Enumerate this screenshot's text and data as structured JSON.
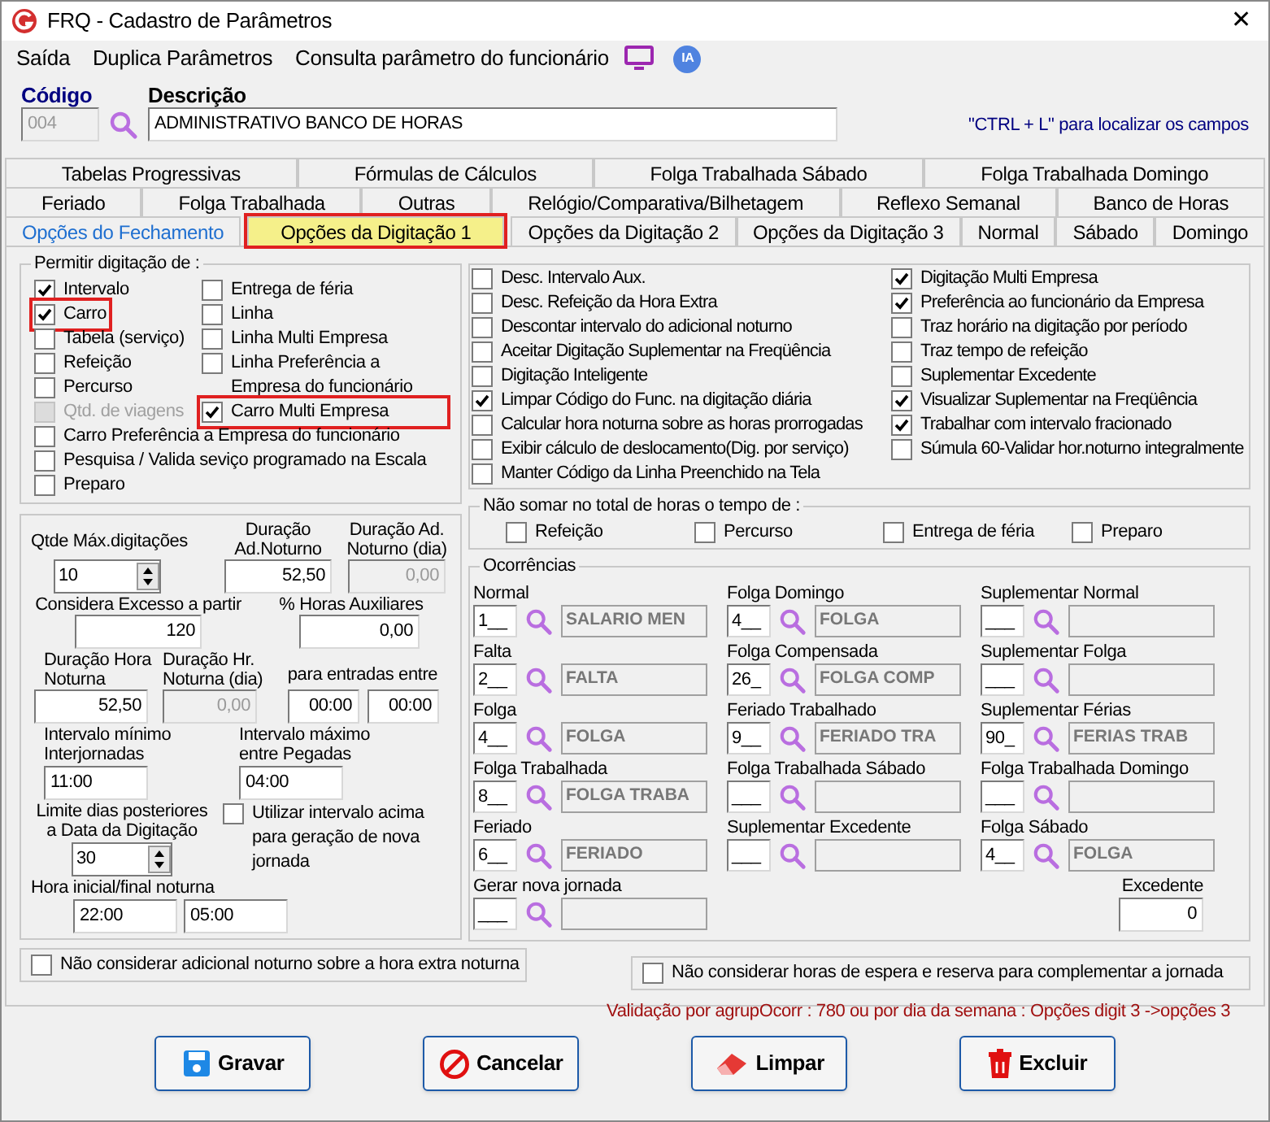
{
  "window": {
    "title": "FRQ - Cadastro de Parâmetros",
    "close": "✕"
  },
  "menu": [
    "Saída",
    "Duplica Parâmetros",
    "Consulta parâmetro do funcionário"
  ],
  "ia_badge": "IA",
  "codigo": {
    "label": "Código",
    "value": "004",
    "disabled": true
  },
  "descricao": {
    "label": "Descrição",
    "value": "ADMINISTRATIVO BANCO DE HORAS",
    "disabled": false
  },
  "hint": "\"CTRL + L\" para localizar os campos",
  "tab_rows": [
    [
      {
        "label": "Tabelas Progressivas",
        "selected": false,
        "highlighted": false,
        "color": "#000000"
      },
      {
        "label": "Fórmulas de Cálculos",
        "selected": false,
        "highlighted": false,
        "color": "#000000"
      },
      {
        "label": "Folga Trabalhada Sábado",
        "selected": false,
        "highlighted": false,
        "color": "#000000"
      },
      {
        "label": "Folga Trabalhada Domingo",
        "selected": false,
        "highlighted": false,
        "color": "#000000"
      }
    ],
    [
      {
        "label": "Feriado",
        "selected": false,
        "highlighted": false,
        "color": "#000000"
      },
      {
        "label": "Folga Trabalhada",
        "selected": false,
        "highlighted": false,
        "color": "#000000"
      },
      {
        "label": "Outras",
        "selected": false,
        "highlighted": false,
        "color": "#000000"
      },
      {
        "label": "Relógio/Comparativa/Bilhetagem",
        "selected": false,
        "highlighted": false,
        "color": "#000000"
      },
      {
        "label": "Reflexo Semanal",
        "selected": false,
        "highlighted": false,
        "color": "#000000"
      },
      {
        "label": "Banco de Horas",
        "selected": false,
        "highlighted": false,
        "color": "#000000"
      }
    ],
    [
      {
        "label": "Opções do Fechamento",
        "selected": false,
        "highlighted": false,
        "color": "#1f6fd0"
      },
      {
        "label": "Opções da Digitação 1",
        "selected": true,
        "highlighted": true
      },
      {
        "label": "Opções da Digitação 2",
        "selected": false,
        "highlighted": false,
        "color": "#000000"
      },
      {
        "label": "Opções da Digitação 3",
        "selected": false,
        "highlighted": false,
        "color": "#000000"
      },
      {
        "label": "Normal",
        "selected": false,
        "highlighted": false,
        "color": "#000000"
      },
      {
        "label": "Sábado",
        "selected": false,
        "highlighted": false,
        "color": "#000000"
      },
      {
        "label": "Domingo",
        "selected": false,
        "highlighted": false,
        "color": "#000000"
      }
    ]
  ],
  "permitir": {
    "title": "Permitir digitação de :",
    "left_items": [
      {
        "label": "Intervalo",
        "checked": true,
        "disabled": false,
        "highlighted": false
      },
      {
        "label": "Carro",
        "checked": true,
        "disabled": false,
        "highlighted": true
      },
      {
        "label": "Tabela (serviço)",
        "checked": false,
        "disabled": false,
        "highlighted": false
      },
      {
        "label": "Refeição",
        "checked": false,
        "disabled": false,
        "highlighted": false
      },
      {
        "label": "Percurso",
        "checked": false,
        "disabled": false,
        "highlighted": false
      },
      {
        "label": "Qtd. de viagens",
        "checked": false,
        "disabled": true,
        "highlighted": false
      }
    ],
    "right_items": [
      {
        "label": "Entrega de féria",
        "checked": false,
        "disabled": false,
        "highlighted": false
      },
      {
        "label": "Linha",
        "checked": false,
        "disabled": false,
        "highlighted": false
      },
      {
        "label": "Linha Multi Empresa",
        "checked": false,
        "disabled": false,
        "highlighted": false
      },
      {
        "label": "Linha Preferência a Empresa do funcionário",
        "checked": false,
        "disabled": false,
        "highlighted": false
      },
      {
        "label": "Carro Multi Empresa",
        "checked": true,
        "disabled": false,
        "highlighted": true
      }
    ],
    "wide_items": [
      {
        "label": "Carro Preferência a Empresa do funcionário",
        "checked": false,
        "disabled": false,
        "highlighted": false
      },
      {
        "label": "Pesquisa / Valida seviço programado na Escala",
        "checked": false,
        "disabled": false,
        "highlighted": false
      },
      {
        "label": "Preparo",
        "checked": false,
        "disabled": false,
        "highlighted": false
      }
    ]
  },
  "options_left": [
    {
      "label": "Desc. Intervalo Aux.",
      "checked": false
    },
    {
      "label": "Desc. Refeição da Hora Extra",
      "checked": false
    },
    {
      "label": "Descontar intervalo do adicional noturno",
      "checked": false
    },
    {
      "label": "Aceitar Digitação Suplementar na Freqüência",
      "checked": false
    },
    {
      "label": "Digitação Inteligente",
      "checked": false
    },
    {
      "label": "Limpar Código do Func. na digitação diária",
      "checked": true
    },
    {
      "label": "Calcular hora noturna sobre as horas prorrogadas",
      "checked": false
    },
    {
      "label": "Exibir cálculo de deslocamento(Dig. por serviço)",
      "checked": false
    },
    {
      "label": "Manter Código da Linha Preenchido na Tela",
      "checked": false
    }
  ],
  "options_right": [
    {
      "label": "Digitação Multi Empresa",
      "checked": true
    },
    {
      "label": "Preferência ao funcionário da Empresa",
      "checked": true
    },
    {
      "label": "Traz horário na digitação por período",
      "checked": false
    },
    {
      "label": "Traz tempo de refeição",
      "checked": false
    },
    {
      "label": "Suplementar Excedente",
      "checked": false
    },
    {
      "label": "Visualizar Suplementar na Freqüência",
      "checked": true
    },
    {
      "label": "Trabalhar com intervalo fracionado",
      "checked": true
    },
    {
      "label": "Súmula 60-Validar hor.noturno integralmente",
      "checked": false
    }
  ],
  "fields": {
    "qtde": {
      "label": "Qtde Máx.digitações",
      "value": "10",
      "disabled": false
    },
    "dur_ad": {
      "label": "Duração Ad.Noturno",
      "value": "52,50",
      "disabled": false
    },
    "dur_ad_dia": {
      "label": "Duração Ad. Noturno (dia)",
      "value": "0,00",
      "disabled": true
    },
    "excesso": {
      "label": "Considera Excesso a partir",
      "value": "120",
      "disabled": false
    },
    "aux": {
      "label": "% Horas Auxiliares",
      "value": "0,00",
      "disabled": false
    },
    "dur_hora": {
      "label": "Duração Hora Noturna",
      "value": "52,50",
      "disabled": false
    },
    "dur_hr_dia": {
      "label": "Duração Hr. Noturna (dia)",
      "value": "0,00",
      "disabled": true
    },
    "entradas": {
      "label": "para entradas entre",
      "values": [
        "00:00",
        "00:00"
      ]
    },
    "int_min": {
      "label": "Intervalo mínimo Interjornadas",
      "value": "11:00",
      "disabled": false
    },
    "int_max": {
      "label": "Intervalo máximo entre Pegadas",
      "value": "04:00",
      "disabled": false
    },
    "limite": {
      "label": "Limite dias posteriores a Data da Digitação",
      "value": "30",
      "disabled": false
    },
    "utilizar": {
      "label": "Utilizar intervalo acima para geração de nova jornada",
      "checked": false
    },
    "hora": {
      "label": "Hora inicial/final noturna",
      "values": [
        "22:00",
        "05:00"
      ]
    }
  },
  "adicional": {
    "label": "Não considerar adicional noturno sobre a hora extra noturna",
    "checked": false
  },
  "nao_somar": {
    "title": "Não somar no total de horas o tempo de :",
    "items": [
      {
        "label": "Refeição",
        "checked": false
      },
      {
        "label": "Percurso",
        "checked": false
      },
      {
        "label": "Entrega de féria",
        "checked": false
      },
      {
        "label": "Preparo",
        "checked": false
      }
    ]
  },
  "ocorrencias": {
    "title": "Ocorrências",
    "columns": [
      [
        {
          "label": "Normal",
          "code": "1__",
          "description": "SALARIO MEN"
        },
        {
          "label": "Falta",
          "code": "2__",
          "description": "FALTA"
        },
        {
          "label": "Folga",
          "code": "4__",
          "description": "FOLGA"
        },
        {
          "label": "Folga Trabalhada",
          "code": "8__",
          "description": "FOLGA TRABA"
        },
        {
          "label": "Feriado",
          "code": "6__",
          "description": "FERIADO"
        },
        {
          "label": "Gerar nova jornada",
          "code": "___"
        }
      ],
      [
        {
          "label": "Folga Domingo",
          "code": "4__",
          "description": "FOLGA"
        },
        {
          "label": "Folga Compensada",
          "code": "26_",
          "description": "FOLGA COMP"
        },
        {
          "label": "Feriado Trabalhado",
          "code": "9__",
          "description": "FERIADO TRA"
        },
        {
          "label": "Folga Trabalhada Sábado",
          "code": "___"
        },
        {
          "label": "Suplementar Excedente",
          "code": "___"
        }
      ],
      [
        {
          "label": "Suplementar Normal",
          "code": "___"
        },
        {
          "label": "Suplementar Folga",
          "code": "___"
        },
        {
          "label": "Suplementar Férias",
          "code": "90_",
          "description": "FERIAS TRAB"
        },
        {
          "label": "Folga Trabalhada Domingo",
          "code": "___"
        },
        {
          "label": "Folga Sábado",
          "code": "4__",
          "description": "FOLGA"
        }
      ]
    ],
    "excedente": {
      "label": "Excedente",
      "value": "0"
    }
  },
  "espera": {
    "label": "Não considerar horas de espera e reserva para complementar a jornada",
    "checked": false
  },
  "validacao": "Validação por agrupOcorr : 780 ou  por  dia da semana : Opções digit 3 ->opções 3",
  "buttons": [
    {
      "label": "Gravar",
      "kind": "save"
    },
    {
      "label": "Cancelar",
      "kind": "cancel"
    },
    {
      "label": "Limpar",
      "kind": "clear"
    },
    {
      "label": "Excluir",
      "kind": "delete"
    }
  ]
}
